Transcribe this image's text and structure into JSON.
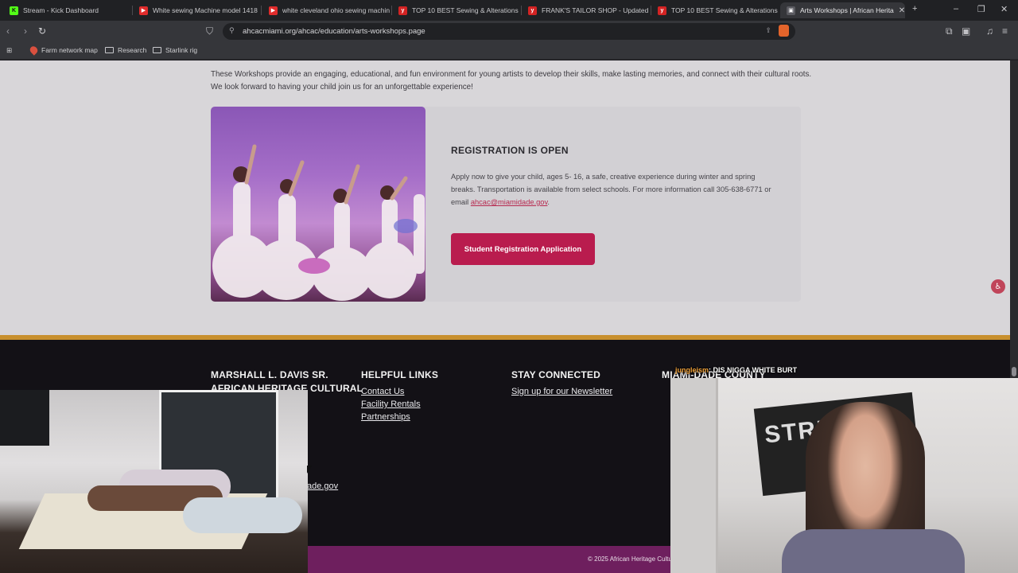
{
  "tabs": [
    {
      "label": "Stream - Kick Dashboard",
      "fav_color": "#53fc18",
      "fav_glyph": "K"
    },
    {
      "label": "White sewing Machine model 1418",
      "fav_color": "#e02c2c",
      "fav_glyph": "▶"
    },
    {
      "label": "white cleveland ohio sewing machin",
      "fav_color": "#e02c2c",
      "fav_glyph": "▶"
    },
    {
      "label": "TOP 10 BEST Sewing & Alterations in",
      "fav_color": "#d32323",
      "fav_glyph": "y"
    },
    {
      "label": "FRANK'S TAILOR SHOP - Updated Ap",
      "fav_color": "#d32323",
      "fav_glyph": "y"
    },
    {
      "label": "TOP 10 BEST Sewing & Alterations n",
      "fav_color": "#d32323",
      "fav_glyph": "y"
    },
    {
      "label": "Arts Workshops | African Herita",
      "fav_color": "#5a5a60",
      "fav_glyph": "▣"
    }
  ],
  "address": {
    "url": "ahcacmiami.org/ahcac/education/arts-workshops.page"
  },
  "bookmarks": [
    {
      "label": "Farm network map"
    },
    {
      "label": "Research"
    },
    {
      "label": "Starlink rig"
    }
  ],
  "content": {
    "intro_line1": "These Workshops provide an engaging, educational, and fun environment for young artists to develop their skills, make lasting memories, and connect with their cultural roots.",
    "intro_line2": "We look forward to having your child join us for an unforgettable experience!",
    "registration_title": "REGISTRATION IS OPEN",
    "registration_body": "Apply now to give your child, ages 5- 16, a safe, creative experience during winter and spring breaks. Transportation is available from select schools. For more information call 305-638-6771 or email ",
    "registration_email": "ahcac@miamidade.gov",
    "registration_period": ".",
    "register_button": "Student Registration Application"
  },
  "footer": {
    "col1_heading_line1": "MARSHALL L. DAVIS SR.",
    "col1_heading_line2": "AFRICAN HERITAGE CULTURAL",
    "col1_link_fragment": "ade.gov",
    "helpful_heading": "HELPFUL LINKS",
    "helpful_links": [
      "Contact Us",
      "Facility Rentals",
      "Partnerships"
    ],
    "stay_heading": "STAY CONNECTED",
    "newsletter_link": "Sign up for our Newsletter",
    "col4_heading": "MIAMI-DADE COUNTY",
    "copyright": "© 2025 African Heritage Cultur"
  },
  "overlay": {
    "chat_user": "jungleism",
    "chat_message": ": DIS NIGGA WHITE BURT",
    "poster_text": "STRE NAT"
  },
  "colors": {
    "accent_button": "#b91c4e",
    "footer_strip": "#c8902e",
    "copyright_bar": "#6e1f5e"
  }
}
